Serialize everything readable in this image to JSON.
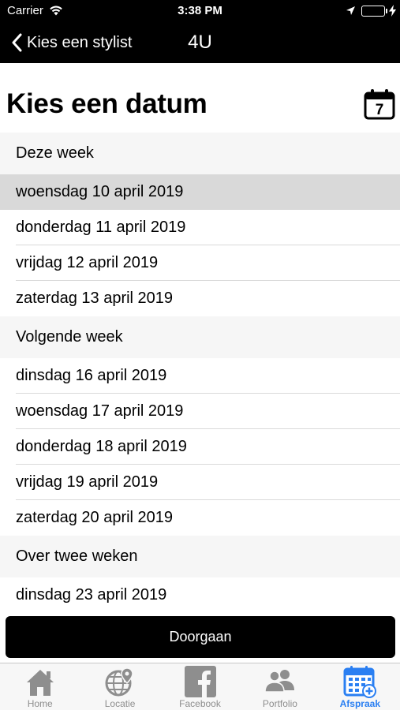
{
  "status_bar": {
    "carrier": "Carrier",
    "time": "3:38 PM",
    "icons": [
      "wifi-icon",
      "location-arrow-icon",
      "battery-icon",
      "charging-bolt-icon"
    ],
    "battery_color": "#4cd964"
  },
  "nav": {
    "back_label": "Kies een stylist",
    "title": "4U",
    "back_icon": "chevron-left-icon"
  },
  "header": {
    "title": "Kies een datum",
    "calendar_day": "7",
    "calendar_icon": "calendar-icon"
  },
  "sections": [
    {
      "title": "Deze week",
      "dates": [
        {
          "label": "woensdag 10 april 2019",
          "selected": true
        },
        {
          "label": "donderdag 11 april 2019",
          "selected": false
        },
        {
          "label": "vrijdag 12 april 2019",
          "selected": false
        },
        {
          "label": "zaterdag 13 april 2019",
          "selected": false
        }
      ]
    },
    {
      "title": "Volgende week",
      "dates": [
        {
          "label": "dinsdag 16 april 2019",
          "selected": false
        },
        {
          "label": "woensdag 17 april 2019",
          "selected": false
        },
        {
          "label": "donderdag 18 april 2019",
          "selected": false
        },
        {
          "label": "vrijdag 19 april 2019",
          "selected": false
        },
        {
          "label": "zaterdag 20 april 2019",
          "selected": false
        }
      ]
    },
    {
      "title": "Over twee weken",
      "dates": [
        {
          "label": "dinsdag 23 april 2019",
          "selected": false
        }
      ]
    }
  ],
  "continue_button": "Doorgaan",
  "tabs": [
    {
      "label": "Home",
      "icon": "home-icon",
      "active": false
    },
    {
      "label": "Locatie",
      "icon": "globe-pin-icon",
      "active": false
    },
    {
      "label": "Facebook",
      "icon": "facebook-icon",
      "active": false
    },
    {
      "label": "Portfolio",
      "icon": "people-icon",
      "active": false
    },
    {
      "label": "Afspraak",
      "icon": "calendar-add-icon",
      "active": true
    }
  ],
  "colors": {
    "bar_background": "#000000",
    "selected_row": "#d9d9d9",
    "section_background": "#f6f6f6",
    "tab_active": "#2a7ff2",
    "tab_inactive": "#8e8e8e"
  }
}
